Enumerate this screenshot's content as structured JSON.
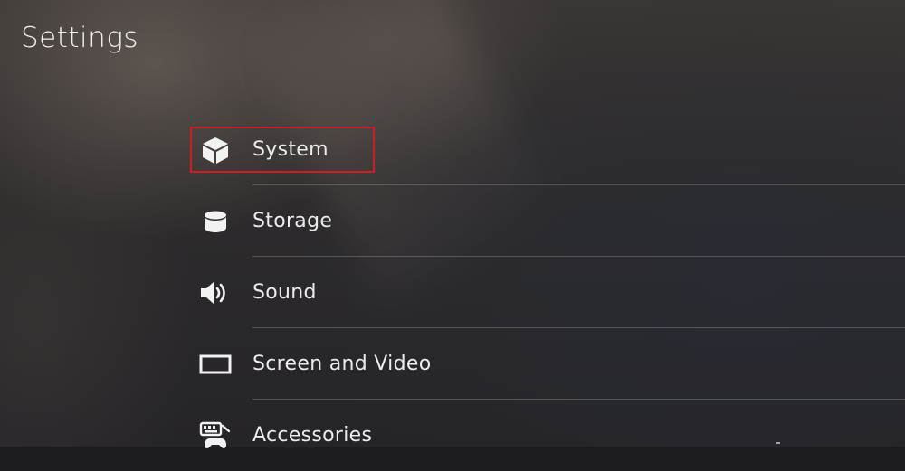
{
  "header": {
    "title": "Settings"
  },
  "menu": {
    "items": [
      {
        "label": "System",
        "icon": "system-cube-icon",
        "focused": true
      },
      {
        "label": "Storage",
        "icon": "storage-cylinder-icon",
        "focused": false
      },
      {
        "label": "Sound",
        "icon": "speaker-icon",
        "focused": false
      },
      {
        "label": "Screen and Video",
        "icon": "screen-rectangle-icon",
        "focused": false
      },
      {
        "label": "Accessories",
        "icon": "keyboard-controller-icon",
        "focused": false
      }
    ]
  },
  "colors": {
    "focus_outline": "#d21c22",
    "text": "#ececec"
  }
}
